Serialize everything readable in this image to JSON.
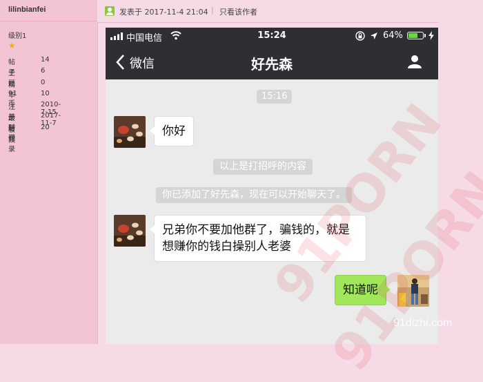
{
  "forum": {
    "username": "lilinbianfei",
    "level": "级别1",
    "stats": [
      {
        "label": "帖子",
        "value": "14"
      },
      {
        "label": "主题",
        "value": "6"
      },
      {
        "label": "精华",
        "value": "0"
      },
      {
        "label": "91币",
        "value": "10"
      },
      {
        "label": "注册时间",
        "value": "2010-7-15"
      },
      {
        "label": "最后登录",
        "value": "2017-11-7"
      },
      {
        "label": "被顶",
        "value": "20"
      }
    ],
    "post_date": "发表于 2017-11-4 21:04",
    "separator": "|",
    "author_only": "只看该作者"
  },
  "phone": {
    "carrier": "中国电信",
    "time": "15:24",
    "battery": "64%",
    "battery_level": 0.64,
    "back_label": "微信",
    "title": "好先森",
    "chat_time": "15:16",
    "messages": [
      {
        "from": "contact",
        "text": "你好"
      },
      {
        "from": "system",
        "text": "以上是打招呼的内容"
      },
      {
        "from": "system",
        "text": "你已添加了好先森，现在可以开始聊天了。"
      },
      {
        "from": "contact",
        "text": "兄弟你不要加他群了，骗钱的，就是想赚你的钱白操别人老婆"
      },
      {
        "from": "me",
        "text": "知道呢"
      }
    ]
  },
  "watermark": {
    "line1": "91PORN",
    "line2": "91PORN",
    "site": "91dizhi.com"
  },
  "colors": {
    "sidebar": "#f3c4d4",
    "page": "#f6dbe6",
    "wechat_bar": "#2f2e33",
    "chat_bg": "#ebebeb",
    "outgoing_bubble": "#a0e75a",
    "star": "#f3b200"
  },
  "icons": [
    "star-icon",
    "post-user-icon",
    "signal-icon",
    "wifi-icon",
    "rotation-lock-icon",
    "location-arrow-icon",
    "battery-icon",
    "charging-icon",
    "back-chevron-icon",
    "profile-icon"
  ]
}
